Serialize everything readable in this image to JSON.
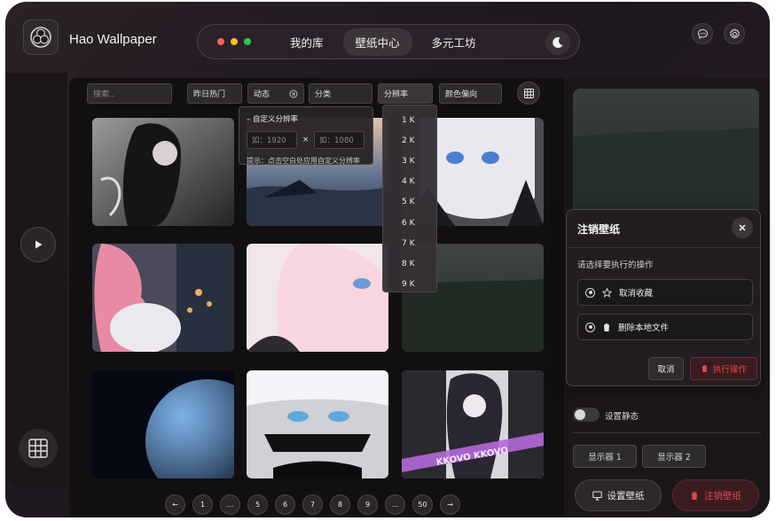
{
  "app": {
    "name": "Hao Wallpaper"
  },
  "nav": {
    "items": [
      {
        "label": "我的库"
      },
      {
        "label": "壁纸中心",
        "active": true
      },
      {
        "label": "多元工坊"
      }
    ],
    "window_dots": [
      "#ff5f57",
      "#febc2e",
      "#28c840"
    ]
  },
  "filters": {
    "search_placeholder": "搜索..",
    "hot": "昨日热门",
    "dynamic": "动态",
    "category": "分类",
    "resolution": "分辨率",
    "color": "颜色偏向"
  },
  "custom_resolution": {
    "title": "– 自定义分辨率",
    "width_placeholder": "如：1920",
    "times": "×",
    "height_placeholder": "如：1080",
    "hint": "提示：点击空白处应用自定义分辨率"
  },
  "resolution_options": [
    "1 K",
    "2 K",
    "3 K",
    "4 K",
    "5 K",
    "6 K",
    "7 K",
    "8 K",
    "9 K"
  ],
  "pagination": [
    "←",
    "1",
    "...",
    "5",
    "6",
    "7",
    "8",
    "9",
    "...",
    "50",
    "→"
  ],
  "gallery": {
    "watermark_text": "KKOVO KKOVO"
  },
  "right_panel": {
    "static_label": "设置静态",
    "monitors": [
      "显示器 1",
      "显示器 2"
    ],
    "set_wallpaper": "设置壁纸",
    "unregister_wallpaper": "注销壁纸"
  },
  "dialog": {
    "title": "注销壁纸",
    "prompt": "请选择要执行的操作",
    "options": [
      "取消收藏",
      "删除本地文件"
    ],
    "cancel": "取消",
    "execute": "执行操作"
  },
  "colors": {
    "accent_red": "#e0484f",
    "danger_bg": "#3a1c20"
  }
}
